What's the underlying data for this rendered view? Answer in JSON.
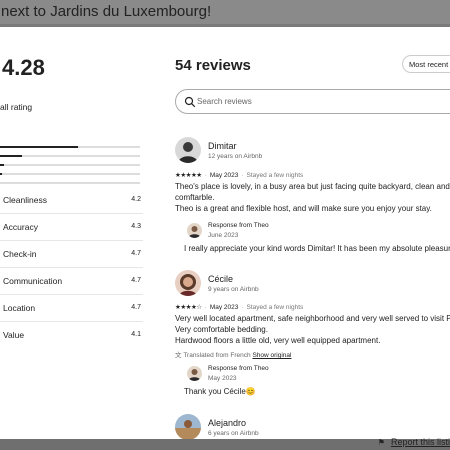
{
  "page": {
    "title_fragment": "next to Jardins du Luxembourg!",
    "report_link": "Report this listi"
  },
  "rating": {
    "overall": "4.28",
    "overall_label": "all rating",
    "distribution": [
      0.56,
      0.04,
      0.03,
      0.0,
      0.01
    ]
  },
  "categories": [
    {
      "name": "Cleanliness",
      "value": "4.2"
    },
    {
      "name": "Accuracy",
      "value": "4.3"
    },
    {
      "name": "Check-in",
      "value": "4.7"
    },
    {
      "name": "Communication",
      "value": "4.7"
    },
    {
      "name": "Location",
      "value": "4.7"
    },
    {
      "name": "Value",
      "value": "4.1"
    }
  ],
  "reviews_header": {
    "count_label": "54 reviews",
    "sort_label": "Most recent",
    "search_placeholder": "Search reviews"
  },
  "reviews": [
    {
      "name": "Dimitar",
      "tenure": "12 years on Airbnb",
      "stars": "★★★★★",
      "date": "May 2023",
      "stay": "Stayed a few nights",
      "lines": [
        "Theo's place is lovely, in a busy area but just facing quite backyard, clean and",
        "comftarble.",
        "Theo is a great and flexible host, and will make sure you enjoy your stay."
      ],
      "response_title": "Response from Theo",
      "response_date": "June 2023",
      "response_text": "I really appreciate your kind words Dimitar! It has been my absolute pleasure!! sor"
    },
    {
      "name": "Cécile",
      "tenure": "9 years on Airbnb",
      "stars": "★★★★☆",
      "date": "May 2023",
      "stay": "Stayed a few nights",
      "lines": [
        "Very well located apartment, safe neighborhood and very well served to visit Par",
        "Very comfortable bedding.",
        "Hardwood floors a little old, very well equipped apartment."
      ],
      "translated_label": "Translated from French",
      "translated_link": "Show original",
      "response_title": "Response from Theo",
      "response_date": "May 2023",
      "response_text": "Thank you Cécile😊"
    },
    {
      "name": "Alejandro",
      "tenure": "6 years on Airbnb"
    }
  ]
}
